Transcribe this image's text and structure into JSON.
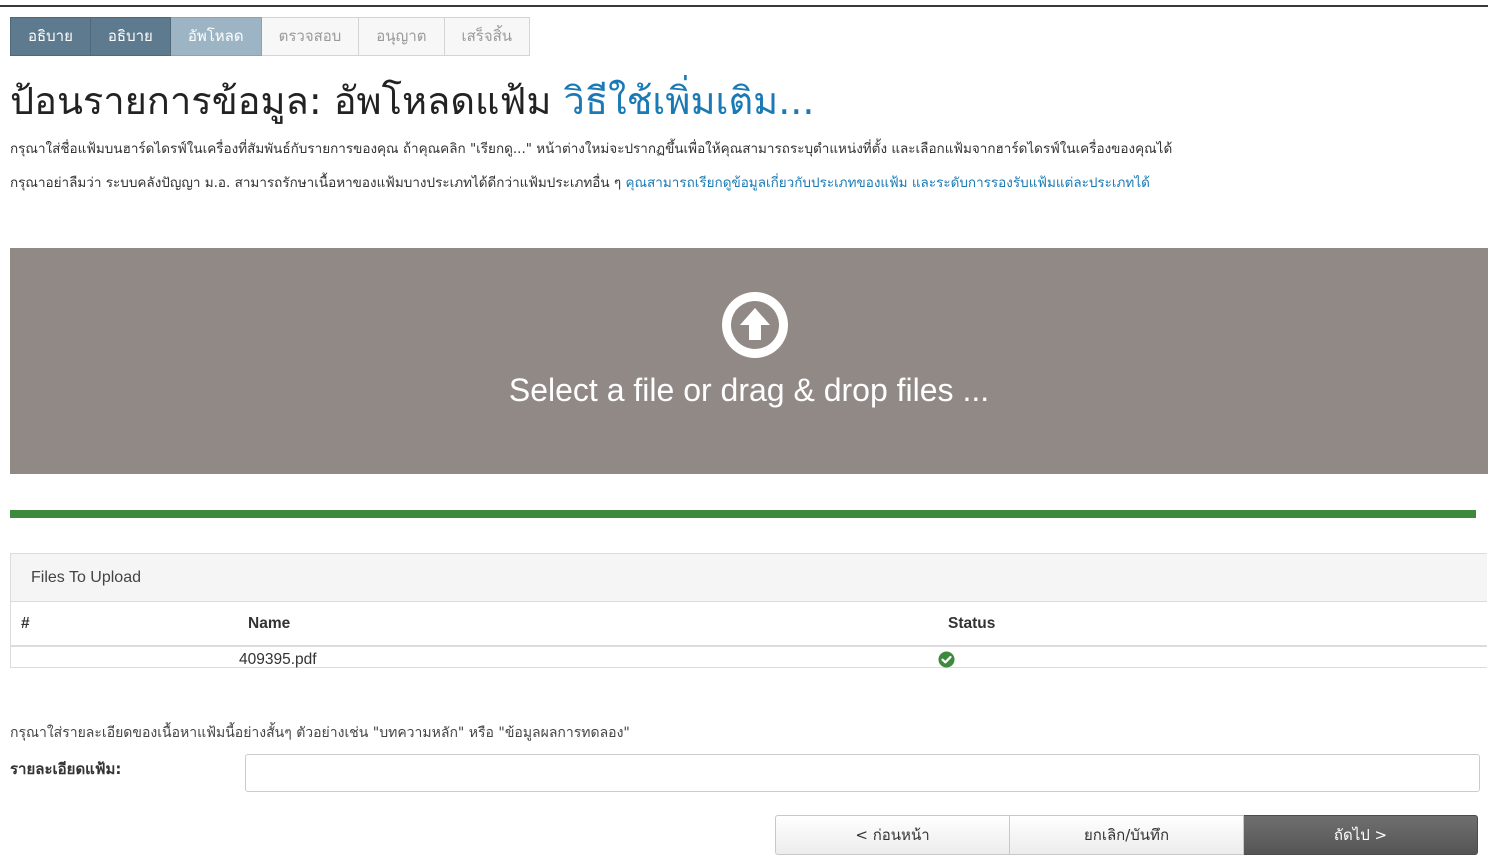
{
  "steps": [
    {
      "label": "อธิบาย",
      "state": "done"
    },
    {
      "label": "อธิบาย",
      "state": "done"
    },
    {
      "label": "อัพโหลด",
      "state": "current"
    },
    {
      "label": "ตรวจสอบ",
      "state": "todo"
    },
    {
      "label": "อนุญาต",
      "state": "todo"
    },
    {
      "label": "เสร็จสิ้น",
      "state": "todo"
    }
  ],
  "page": {
    "title": "ป้อนรายการข้อมูล: อัพโหลดแฟ้ม",
    "help_link": "วิธีใช้เพิ่มเติม..."
  },
  "instructions": {
    "line1": "กรุณาใส่ชื่อแฟ้มบนฮาร์ดไดรฟ์ในเครื่องที่สัมพันธ์กับรายการของคุณ ถ้าคุณคลิก \"เรียกดู...\" หน้าต่างใหม่จะปรากฏขึ้นเพื่อให้คุณสามารถระบุตำแหน่งที่ตั้ง และเลือกแฟ้มจากฮาร์ดไดรฟ์ในเครื่องของคุณได้",
    "line2_text": "กรุณาอย่าลืมว่า ระบบคลังปัญญา ม.อ. สามารถรักษาเนื้อหาของแฟ้มบางประเภทได้ดีกว่าแฟ้มประเภทอื่น ๆ ",
    "line2_link": "คุณสามารถเรียกดูข้อมูลเกี่ยวกับประเภทของแฟ้ม และระดับการรองรับแฟ้มแต่ละประเภทได้"
  },
  "dropzone": {
    "text": "Select a file or drag & drop files ...",
    "icon": "upload-arrow-circle-icon"
  },
  "progress": {
    "value": 1.0,
    "color": "#3e8a3c"
  },
  "files": {
    "panel_title": "Files To Upload",
    "columns": [
      "#",
      "Name",
      "Status"
    ],
    "rows": [
      {
        "num": "",
        "name": "409395.pdf",
        "status_icon": "check-circle-icon",
        "status_color": "#3e8a3c"
      }
    ]
  },
  "description": {
    "help": "กรุณาใส่รายละเอียดของเนื้อหาแฟ้มนี้อย่างสั้นๆ ตัวอย่างเช่น \"บทความหลัก\" หรือ \"ข้อมูลผลการทดลอง\"",
    "label": "รายละเอียดแฟ้ม:",
    "value": ""
  },
  "buttons": {
    "prev": "< ก่อนหน้า",
    "cancel": "ยกเลิก/บันทึก",
    "next": "ถัดไป >"
  }
}
